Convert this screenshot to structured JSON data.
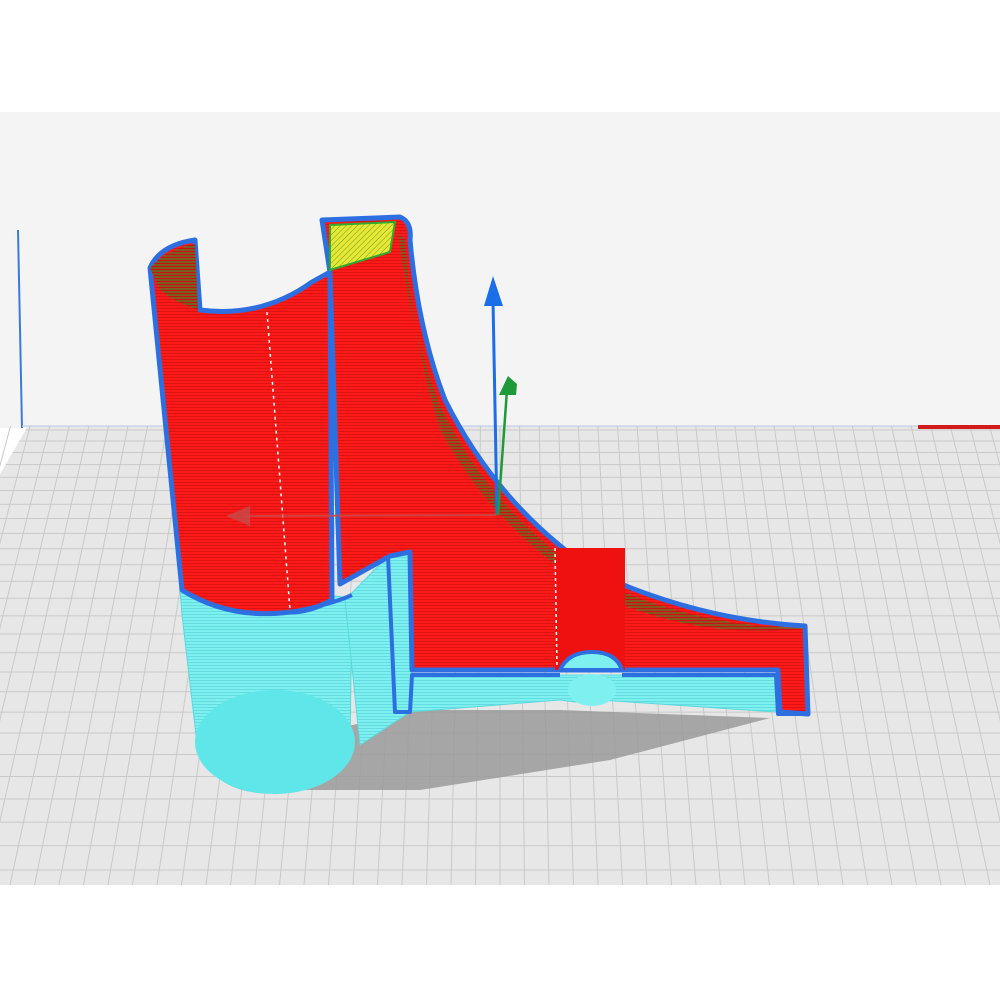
{
  "app": {
    "title": "",
    "view": "layer-preview"
  },
  "scene": {
    "background_color": "#ffffff",
    "backdrop_color": "#f4f4f4",
    "build_plate_color": "#e7e7e7",
    "grid_line_color": "#c9c9c9",
    "model_layer_color": "#ff1a1a",
    "model_dark_layer_color": "#c80c0c",
    "model_preview_color": "#5ee6e8",
    "outline_color": "#2d6fe0",
    "inner_wall_color": "#33cc33",
    "top_skin_color": "#e8e834",
    "shadow_color": "#9a9a9a"
  },
  "axes": {
    "x_axis_color": "#d11a1a",
    "y_axis_color": "#1f9a3a",
    "z_axis_color": "#1a6fe8",
    "left_edge_color": "#3a7ae0"
  }
}
